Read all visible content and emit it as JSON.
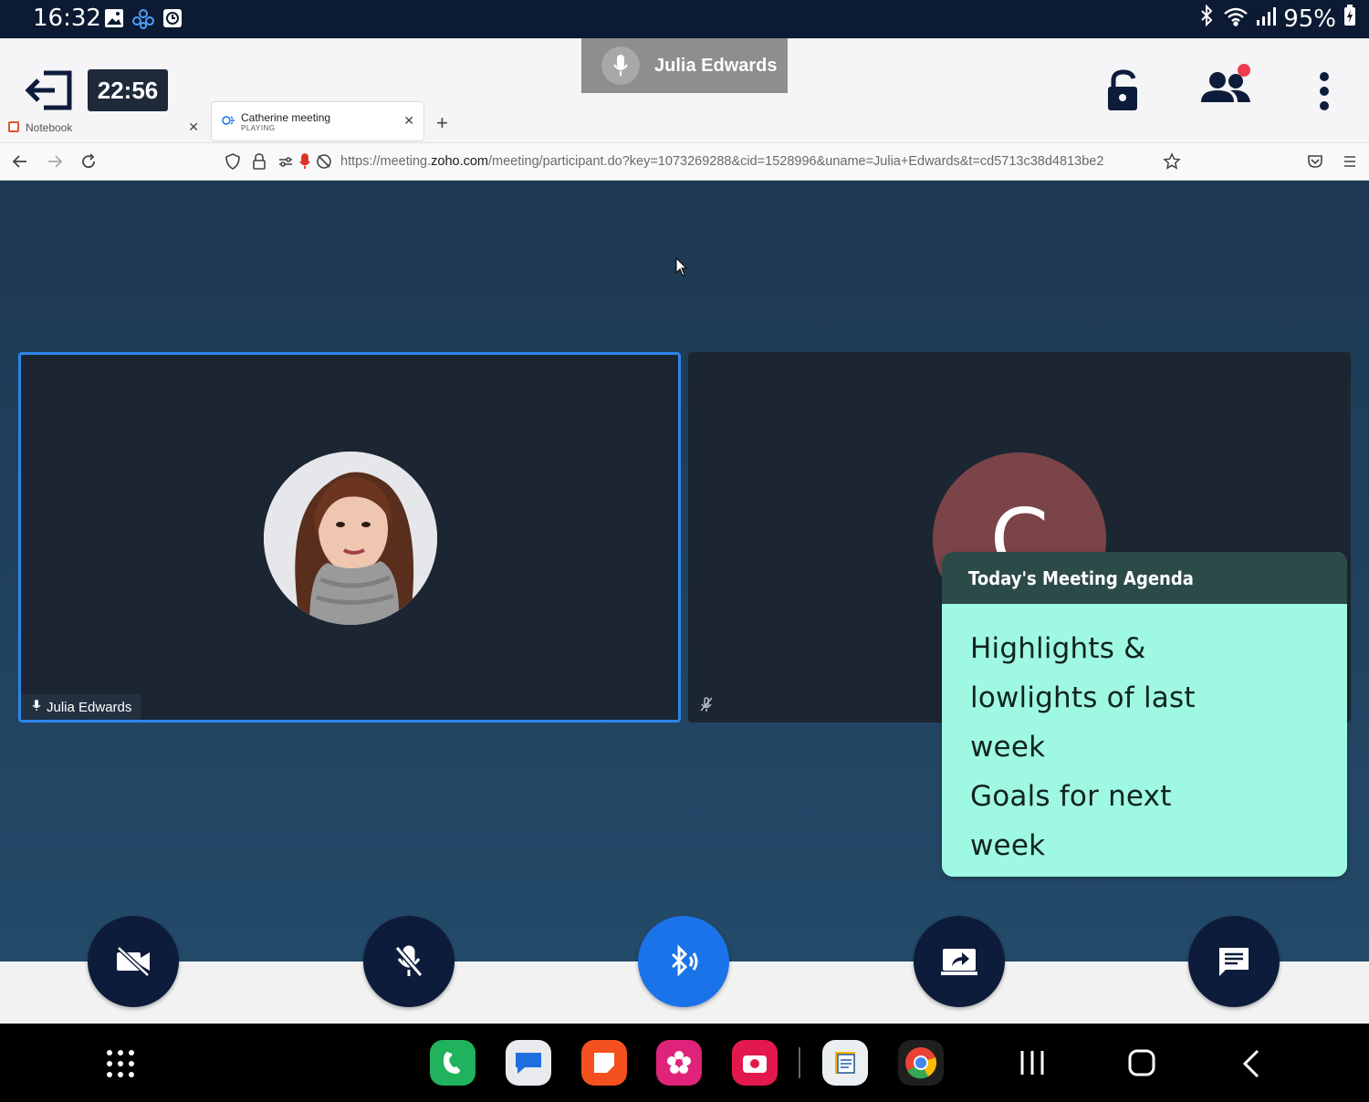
{
  "status_bar": {
    "time": "16:32",
    "battery": "95%"
  },
  "meeting": {
    "elapsed": "22:56",
    "active_speaker": "Julia Edwards"
  },
  "browser": {
    "tabs": [
      {
        "label": "Notebook"
      },
      {
        "label": "Catherine meeting",
        "sublabel": "PLAYING"
      }
    ],
    "url_prefix": "https://meeting.",
    "url_domain": "zoho.com",
    "url_rest": "/meeting/participant.do?key=1073269288&cid=1528996&uname=Julia+Edwards&t=cd5713c38d4813be2"
  },
  "participants": [
    {
      "name": "Julia Edwards"
    },
    {
      "initial": "C"
    }
  ],
  "agenda_note": {
    "title": "Today's Meeting Agenda",
    "lines": [
      "Highlights &",
      "lowlights of last",
      "week",
      "Goals for next",
      "week"
    ]
  },
  "controls": [
    "camera-off",
    "mic-off",
    "bluetooth-audio",
    "share-screen",
    "chat"
  ],
  "colors": {
    "accent": "#1a73e8",
    "tile_border": "#2d85e8",
    "note_bg": "#9ff8e2",
    "note_header": "#2c4a48",
    "avatar_c": "#7b4448",
    "notification_dot": "#f13c4f"
  }
}
